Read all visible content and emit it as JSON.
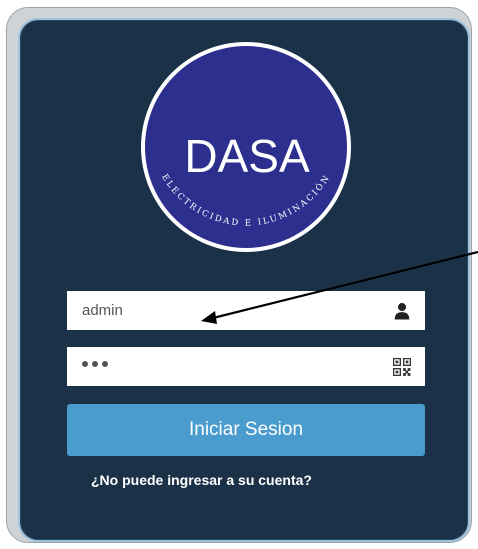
{
  "brand": {
    "name": "DASA",
    "tagline": "ELECTRICIDAD E ILUMINACIÓN",
    "circle_color": "#2d2f8f"
  },
  "login": {
    "username_value": "admin",
    "username_icon": "user-icon",
    "password_value": "•••",
    "password_icon": "qr-code-icon",
    "submit_label": "Iniciar Sesion",
    "forgot_label": "¿No puede ingresar a su cuenta?"
  },
  "colors": {
    "panel": "#1b3147",
    "button": "#4a9ccf"
  }
}
